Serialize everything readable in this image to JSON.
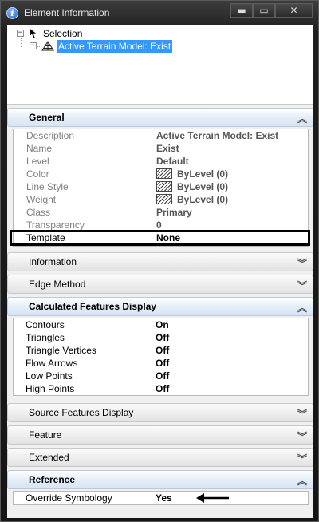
{
  "window": {
    "title": "Element Information",
    "controls": {
      "minimize": "▬",
      "maximize": "▭",
      "close": "✕"
    }
  },
  "tree": {
    "root_label": "Selection",
    "child_label": "Active Terrain Model: Exist"
  },
  "sections": {
    "general": {
      "label": "General",
      "rows": [
        {
          "name": "Description",
          "value": "Active Terrain Model: Exist"
        },
        {
          "name": "Name",
          "value": "Exist"
        },
        {
          "name": "Level",
          "value": "Default"
        },
        {
          "name": "Color",
          "value": "ByLevel (0)"
        },
        {
          "name": "Line Style",
          "value": "ByLevel (0)"
        },
        {
          "name": "Weight",
          "value": "ByLevel (0)"
        },
        {
          "name": "Class",
          "value": "Primary"
        },
        {
          "name": "Transparency",
          "value": "0"
        },
        {
          "name": "Template",
          "value": "None"
        }
      ]
    },
    "information": {
      "label": "Information"
    },
    "edge_method": {
      "label": "Edge Method"
    },
    "calculated": {
      "label": "Calculated Features Display",
      "rows": [
        {
          "name": "Contours",
          "value": "On"
        },
        {
          "name": "Triangles",
          "value": "Off"
        },
        {
          "name": "Triangle Vertices",
          "value": "Off"
        },
        {
          "name": "Flow Arrows",
          "value": "Off"
        },
        {
          "name": "Low Points",
          "value": "Off"
        },
        {
          "name": "High Points",
          "value": "Off"
        }
      ]
    },
    "source_features": {
      "label": "Source Features Display"
    },
    "feature": {
      "label": "Feature"
    },
    "extended": {
      "label": "Extended"
    },
    "reference": {
      "label": "Reference",
      "rows": [
        {
          "name": "Override Symbology",
          "value": "Yes"
        }
      ]
    }
  },
  "icons": {
    "collapse": "chevron-up-icon",
    "expand": "chevron-down-icon"
  },
  "colors": {
    "selection": "#3399ff",
    "header_open": "#d6e4f5"
  }
}
